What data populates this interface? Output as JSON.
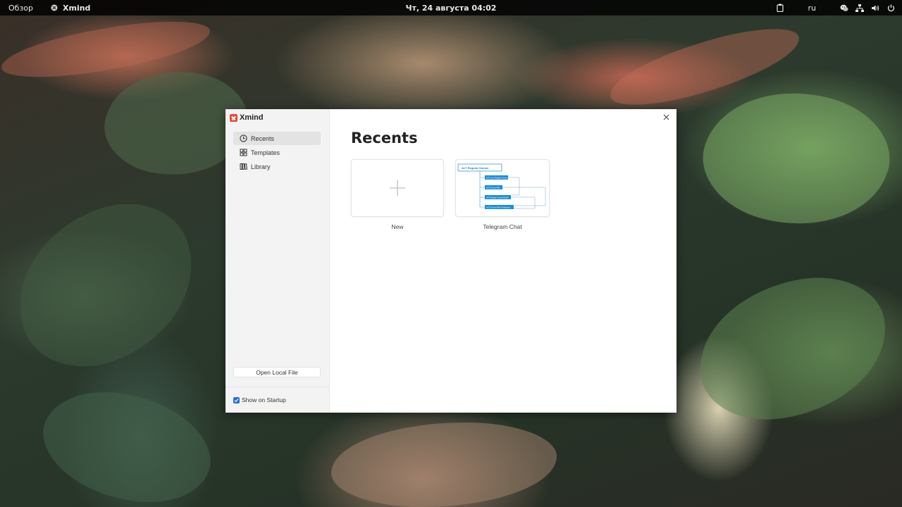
{
  "topbar": {
    "activities": "Обзор",
    "app_name": "Xmind",
    "datetime": "Чт, 24 августа  04:02",
    "keyboard_layout": "ru",
    "icons": [
      "clipboard-icon",
      "wechat-icon",
      "network-icon",
      "volume-icon",
      "power-icon"
    ]
  },
  "window": {
    "brand": "Xmind",
    "brand_color": "#e8483d",
    "sidebar": {
      "items": [
        {
          "label": "Recents",
          "icon": "clock-icon",
          "active": true
        },
        {
          "label": "Templates",
          "icon": "templates-icon",
          "active": false
        },
        {
          "label": "Library",
          "icon": "library-icon",
          "active": false
        }
      ],
      "open_local": "Open Local File",
      "show_on_startup": "Show on Startup",
      "show_on_startup_checked": true
    },
    "main": {
      "title": "Recents",
      "cards": [
        {
          "label": "New",
          "type": "new"
        },
        {
          "label": "Telegram Chat",
          "type": "file",
          "thumbnail": {
            "root": "ALT Regular Gnome",
            "topics": [
              "ALT Linux Regular Gnome",
              "ALT Gnome Wiki",
              "ALT Regular Gnome Builds",
              "ALT Gnome Wiki Translations"
            ]
          }
        }
      ]
    }
  }
}
